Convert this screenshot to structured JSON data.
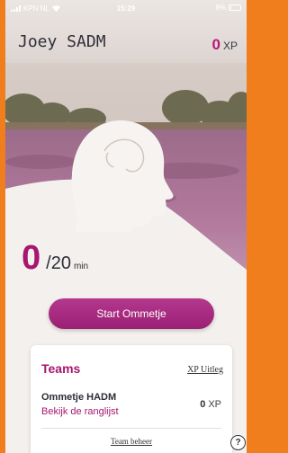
{
  "status_bar": {
    "carrier": "KPN NL",
    "time": "15:29",
    "battery": "8%",
    "battery_level": 0.08
  },
  "header": {
    "user_name": "Joey SADM",
    "xp_value": "0",
    "xp_unit": "XP"
  },
  "progress": {
    "minutes_done": "0",
    "minutes_goal": "/20",
    "unit": "min"
  },
  "start_button": {
    "label": "Start Ommetje"
  },
  "teams_card": {
    "title": "Teams",
    "xp_info_link": "XP Uitleg",
    "team": {
      "name": "Ommetje HADM",
      "ranking_link": "Bekijk de ranglijst",
      "xp_value": "0",
      "xp_unit": "XP"
    },
    "manage_link": "Team beheer"
  },
  "help_button": {
    "label": "?"
  },
  "colors": {
    "accent": "#a7166f",
    "frame": "#f07e1c",
    "background": "#f3f0ed"
  },
  "icons": [
    "wifi-icon",
    "signal-icon",
    "battery-icon",
    "head-silhouette-icon",
    "help-icon"
  ]
}
